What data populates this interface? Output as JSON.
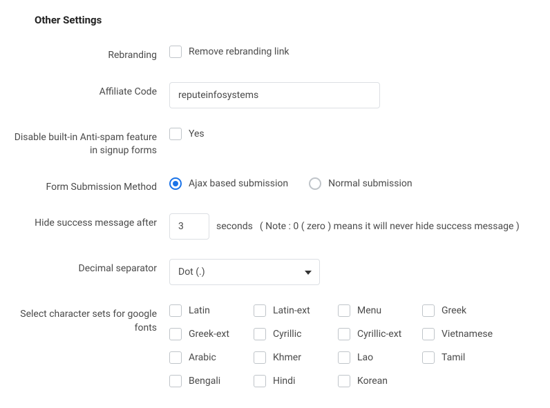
{
  "section_title": "Other Settings",
  "rebranding": {
    "label": "Rebranding",
    "checkbox_label": "Remove rebranding link"
  },
  "affiliate": {
    "label": "Affiliate Code",
    "value": "reputeinfosystems"
  },
  "antispam": {
    "label": "Disable built-in Anti-spam feature in signup forms",
    "checkbox_label": "Yes"
  },
  "submission": {
    "label": "Form Submission Method",
    "options": {
      "ajax": "Ajax based submission",
      "normal": "Normal submission"
    }
  },
  "hide_msg": {
    "label": "Hide success message after",
    "value": "3",
    "unit": "seconds",
    "note": "( Note : 0 ( zero ) means it will never hide success message )"
  },
  "decimal": {
    "label": "Decimal separator",
    "selected": "Dot (.)"
  },
  "charsets": {
    "label": "Select character sets for google fonts",
    "items": [
      "Latin",
      "Latin-ext",
      "Menu",
      "Greek",
      "Greek-ext",
      "Cyrillic",
      "Cyrillic-ext",
      "Vietnamese",
      "Arabic",
      "Khmer",
      "Lao",
      "Tamil",
      "Bengali",
      "Hindi",
      "Korean"
    ]
  }
}
